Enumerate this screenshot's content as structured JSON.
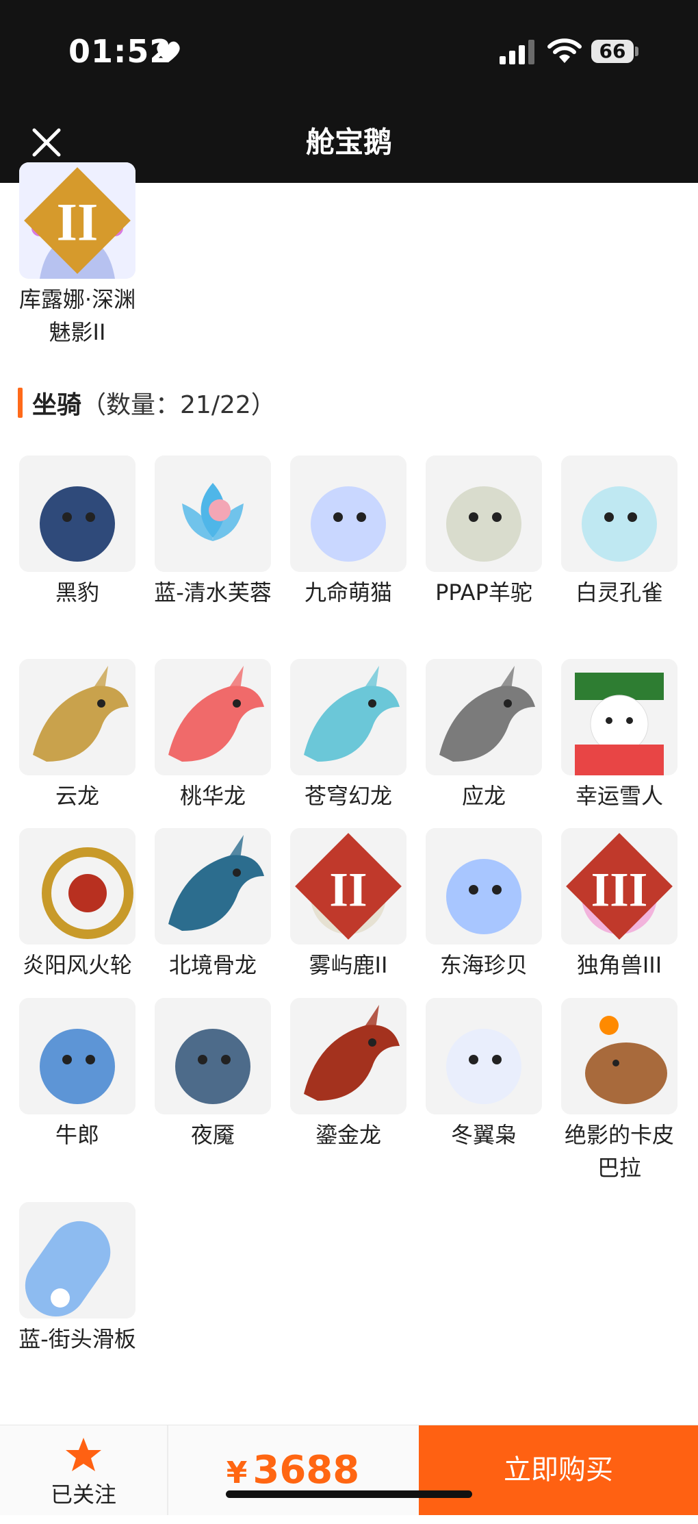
{
  "status": {
    "time": "01:52",
    "battery": "66"
  },
  "nav": {
    "title": "舱宝鹅"
  },
  "top_item": {
    "label": "库露娜·深渊魅影II"
  },
  "section": {
    "title": "坐骑",
    "count": "（数量：21/22）"
  },
  "mounts": [
    {
      "label": "黑豹",
      "color": "#2f4a7a"
    },
    {
      "label": "蓝-清水芙蓉",
      "color": "#4fb6e8"
    },
    {
      "label": "九命萌猫",
      "color": "#c9d7ff"
    },
    {
      "label": "PPAP羊驼",
      "color": "#d9dccd"
    },
    {
      "label": "白灵孔雀",
      "color": "#bfe8f2"
    },
    {
      "label": "云龙",
      "color": "#c9a24c"
    },
    {
      "label": "桃华龙",
      "color": "#f06a6a"
    },
    {
      "label": "苍穹幻龙",
      "color": "#6bc7d8"
    },
    {
      "label": "应龙",
      "color": "#7b7b7b"
    },
    {
      "label": "幸运雪人",
      "color": "#e84545"
    },
    {
      "label": "炎阳风火轮",
      "color": "#c89a2a"
    },
    {
      "label": "北境骨龙",
      "color": "#2c6d8e"
    },
    {
      "label": "雾屿鹿II",
      "color": "#e6e1d2"
    },
    {
      "label": "东海珍贝",
      "color": "#a8c6ff"
    },
    {
      "label": "独角兽III",
      "color": "#f2b3dc"
    },
    {
      "label": "牛郎",
      "color": "#5d95d6"
    },
    {
      "label": "夜魇",
      "color": "#4d6b8a"
    },
    {
      "label": "鎏金龙",
      "color": "#a4321e"
    },
    {
      "label": "冬翼枭",
      "color": "#e9eefc"
    },
    {
      "label": "绝影的卡皮巴拉",
      "color": "#a86a3c"
    },
    {
      "label": "蓝-街头滑板",
      "color": "#8dbbf0"
    }
  ],
  "bottom": {
    "follow_label": "已关注",
    "currency": "¥",
    "price": "3688",
    "buy_label": "立即购买"
  },
  "colors": {
    "accent": "#ff6112",
    "bar_bg": "#131313"
  }
}
